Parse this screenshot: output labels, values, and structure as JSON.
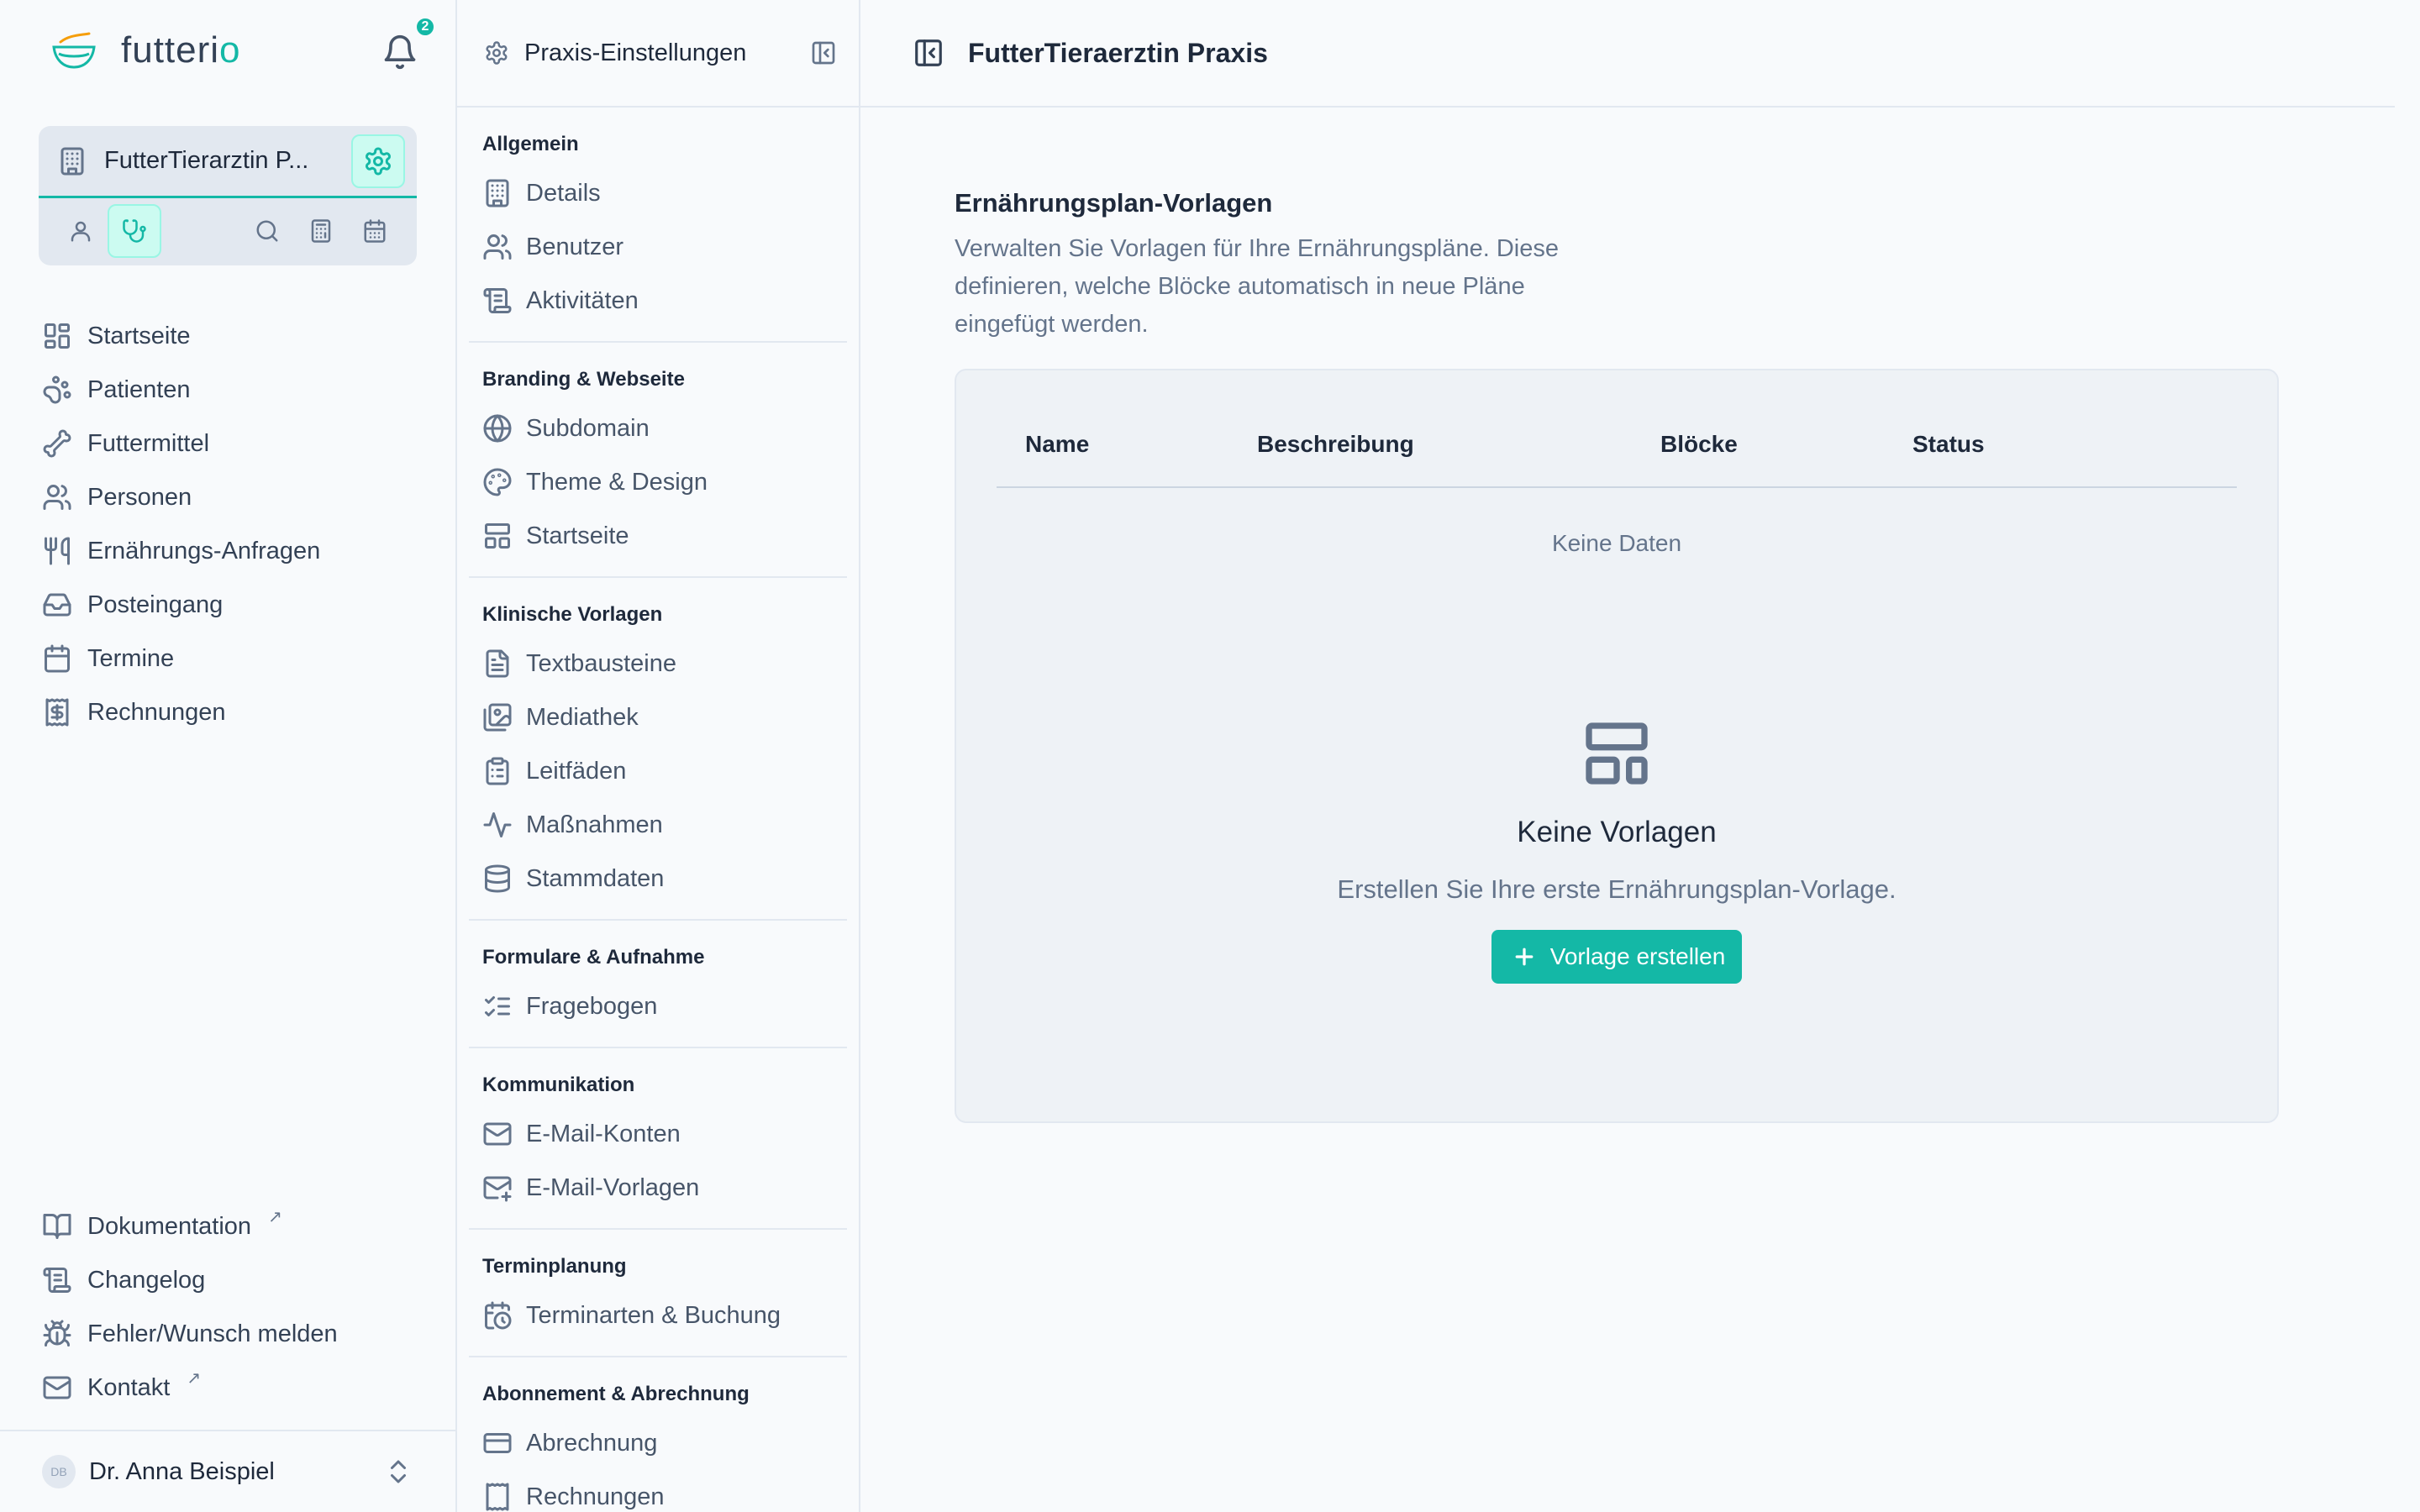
{
  "app": {
    "logo_text_main": "futteri",
    "logo_text_accent": "o",
    "notification_count": "2"
  },
  "org": {
    "name": "FutterTierarztin P..."
  },
  "nav": {
    "items": [
      {
        "label": "Startseite",
        "icon": "dashboard-icon"
      },
      {
        "label": "Patienten",
        "icon": "paw-icon"
      },
      {
        "label": "Futtermittel",
        "icon": "bone-icon"
      },
      {
        "label": "Personen",
        "icon": "users-icon"
      },
      {
        "label": "Ernährungs-Anfragen",
        "icon": "utensils-icon"
      },
      {
        "label": "Posteingang",
        "icon": "inbox-icon"
      },
      {
        "label": "Termine",
        "icon": "calendar-icon"
      },
      {
        "label": "Rechnungen",
        "icon": "receipt-icon"
      }
    ],
    "bottom": [
      {
        "label": "Dokumentation",
        "icon": "book-icon",
        "external": "↗"
      },
      {
        "label": "Changelog",
        "icon": "scroll-icon",
        "external": ""
      },
      {
        "label": "Fehler/Wunsch melden",
        "icon": "bug-icon",
        "external": ""
      },
      {
        "label": "Kontakt",
        "icon": "mail-icon",
        "external": "↗"
      }
    ]
  },
  "user": {
    "initials": "DB",
    "name": "Dr. Anna Beispiel"
  },
  "settings": {
    "title": "Praxis-Einstellungen",
    "groups": [
      {
        "title": "Allgemein",
        "items": [
          "Details",
          "Benutzer",
          "Aktivitäten"
        ]
      },
      {
        "title": "Branding & Webseite",
        "items": [
          "Subdomain",
          "Theme & Design",
          "Startseite"
        ]
      },
      {
        "title": "Klinische Vorlagen",
        "items": [
          "Textbausteine",
          "Mediathek",
          "Leitfäden",
          "Maßnahmen",
          "Stammdaten"
        ]
      },
      {
        "title": "Formulare & Aufnahme",
        "items": [
          "Fragebogen"
        ]
      },
      {
        "title": "Kommunikation",
        "items": [
          "E-Mail-Konten",
          "E-Mail-Vorlagen"
        ]
      },
      {
        "title": "Terminplanung",
        "items": [
          "Terminarten & Buchung"
        ]
      },
      {
        "title": "Abonnement & Abrechnung",
        "items": [
          "Abrechnung",
          "Rechnungen"
        ]
      }
    ]
  },
  "main": {
    "header_title": "FutterTieraerztin Praxis",
    "section_title": "Ernährungsplan-Vorlagen",
    "section_desc": "Verwalten Sie Vorlagen für Ihre Ernährungspläne. Diese definieren, welche Blöcke automatisch in neue Pläne eingefügt werden.",
    "table": {
      "columns": [
        "Name",
        "Beschreibung",
        "Blöcke",
        "Status"
      ],
      "no_data": "Keine Daten"
    },
    "empty": {
      "title": "Keine Vorlagen",
      "desc": "Erstellen Sie Ihre erste Ernährungsplan-Vorlage.",
      "button": "Vorlage erstellen"
    }
  }
}
